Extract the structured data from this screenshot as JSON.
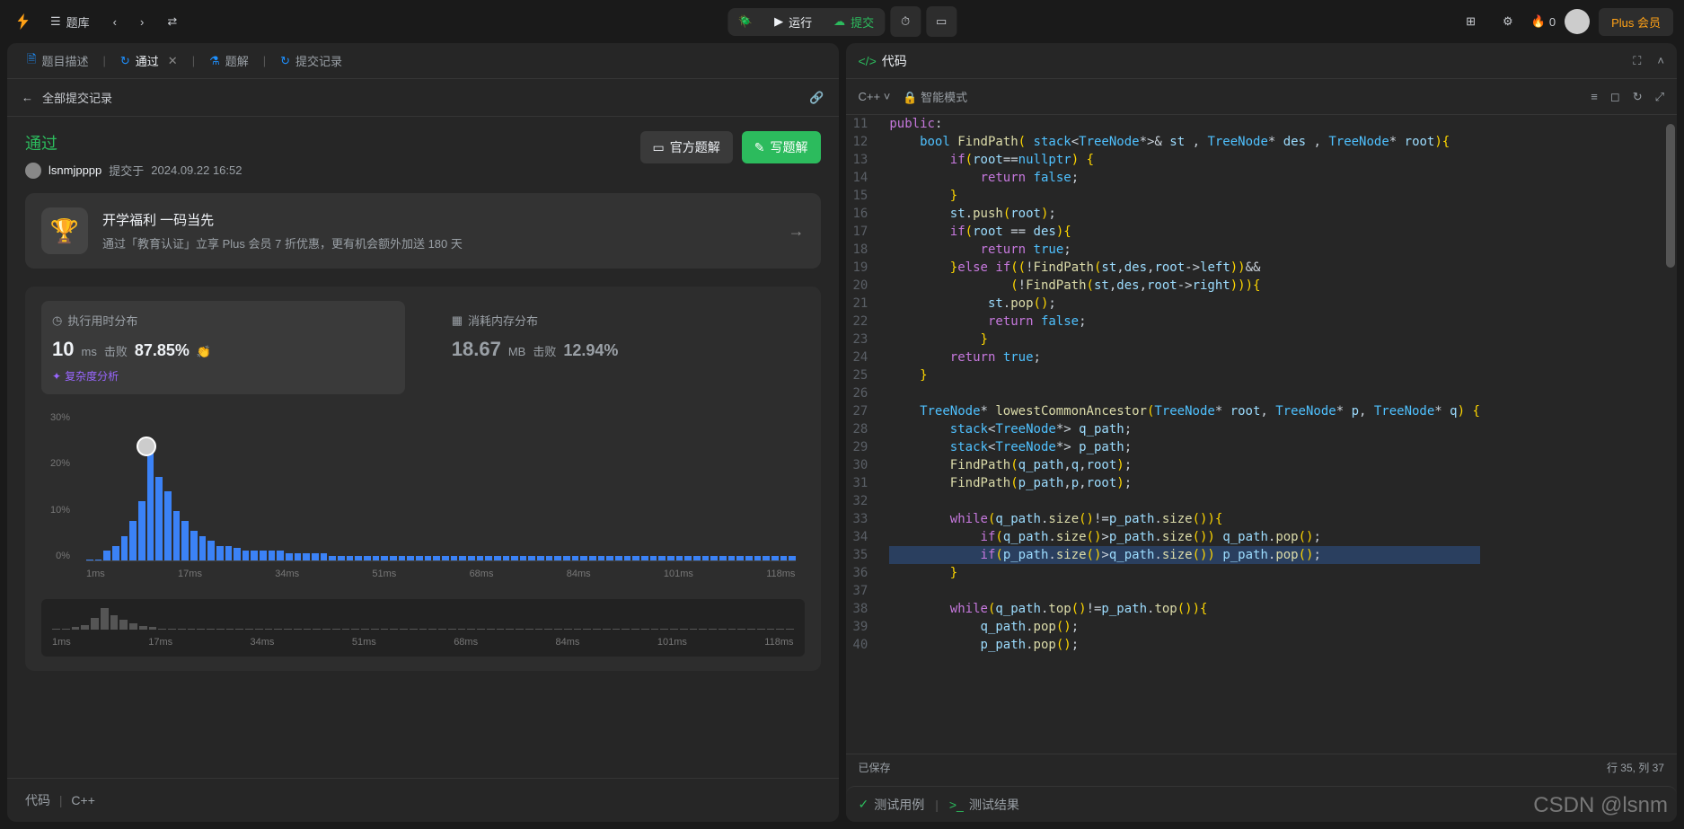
{
  "topbar": {
    "problem_list": "题库",
    "run": "运行",
    "submit": "提交",
    "flame_count": "0",
    "plus": "Plus 会员"
  },
  "left_tabs": {
    "desc": "题目描述",
    "pass": "通过",
    "solution": "题解",
    "history": "提交记录"
  },
  "subhead": {
    "back": "←",
    "all_sub": "全部提交记录"
  },
  "result": {
    "status": "通过",
    "user": "lsnmjpppp",
    "submitted_prefix": "提交于",
    "submitted_at": "2024.09.22 16:52",
    "official": "官方题解",
    "write": "写题解"
  },
  "promo": {
    "title": "开学福利 一码当先",
    "subtitle": "通过「教育认证」立享 Plus 会员 7 折优惠，更有机会额外加送 180 天"
  },
  "stats": {
    "time_label": "执行用时分布",
    "mem_label": "消耗内存分布",
    "time_val": "10",
    "time_unit": "ms",
    "beat_label": "击败",
    "time_pct": "87.85%",
    "mem_val": "18.67",
    "mem_unit": "MB",
    "mem_pct": "12.94%",
    "complexity": "复杂度分析"
  },
  "chart_data": {
    "type": "bar",
    "ylabel": "",
    "ylim": [
      0,
      30
    ],
    "yticks": [
      "0%",
      "10%",
      "20%",
      "30%"
    ],
    "xticks": [
      "1ms",
      "17ms",
      "34ms",
      "51ms",
      "68ms",
      "84ms",
      "101ms",
      "118ms"
    ],
    "values": [
      0,
      0,
      2,
      3,
      5,
      8,
      12,
      22,
      17,
      14,
      10,
      8,
      6,
      5,
      4,
      3,
      3,
      2.5,
      2,
      2,
      2,
      2,
      2,
      1.5,
      1.5,
      1.5,
      1.5,
      1.5,
      1,
      1,
      1,
      1,
      1,
      1,
      1,
      1,
      1,
      1,
      1,
      1,
      1,
      1,
      1,
      1,
      1,
      1,
      1,
      1,
      1,
      1,
      1,
      1,
      1,
      1,
      1,
      1,
      1,
      1,
      1,
      1,
      1,
      1,
      1,
      1,
      1,
      1,
      1,
      1,
      1,
      1,
      1,
      1,
      1,
      1,
      1,
      1,
      1,
      1,
      1,
      1,
      1,
      1
    ],
    "user_index": 7,
    "mini_values": [
      0,
      0,
      2,
      4,
      10,
      18,
      12,
      8,
      5,
      3,
      2,
      1,
      1,
      1,
      1,
      1,
      1,
      0,
      0,
      0,
      0,
      0,
      0,
      0,
      0,
      0,
      0,
      0,
      0,
      0,
      0,
      0,
      0,
      0,
      0,
      0,
      0,
      0,
      0,
      0,
      0,
      0,
      0,
      0,
      0,
      0,
      0,
      0,
      0,
      0,
      0,
      0,
      0,
      0,
      0,
      0,
      0,
      0,
      0,
      0,
      0,
      0,
      0,
      0,
      0,
      0,
      0,
      0,
      0,
      0,
      0,
      0,
      0,
      0,
      0,
      0,
      0
    ]
  },
  "code_footer": {
    "label": "代码",
    "lang": "C++"
  },
  "right": {
    "title": "代码",
    "lang": "C++",
    "smart": "智能模式",
    "saved": "已保存",
    "cursor": "行 35,  列 37",
    "test_case": "测试用例",
    "test_result": "测试结果"
  },
  "code": {
    "lines": [
      {
        "n": 11,
        "html": "<span class='kw'>public</span><span class='pun'>:</span>"
      },
      {
        "n": 12,
        "html": "    <span class='ty'>bool</span> <span class='fn'>FindPath</span><span class='br'>(</span> <span class='ty'>stack</span>&lt;<span class='ty'>TreeNode</span>*&gt;&amp; <span class='id'>st</span> , <span class='ty'>TreeNode</span>* <span class='id'>des</span> , <span class='ty'>TreeNode</span>* <span class='id'>root</span><span class='br'>){</span>"
      },
      {
        "n": 13,
        "html": "        <span class='kw'>if</span><span class='br'>(</span><span class='id'>root</span>==<span class='bool'>nullptr</span><span class='br'>)</span> <span class='br'>{</span>"
      },
      {
        "n": 14,
        "html": "            <span class='kw'>return</span> <span class='bool'>false</span>;"
      },
      {
        "n": 15,
        "html": "        <span class='br'>}</span>"
      },
      {
        "n": 16,
        "html": "        <span class='id'>st</span>.<span class='fn'>push</span><span class='br'>(</span><span class='id'>root</span><span class='br'>)</span>;"
      },
      {
        "n": 17,
        "html": "        <span class='kw'>if</span><span class='br'>(</span><span class='id'>root</span> == <span class='id'>des</span><span class='br'>){</span>"
      },
      {
        "n": 18,
        "html": "            <span class='kw'>return</span> <span class='bool'>true</span>;"
      },
      {
        "n": 19,
        "html": "        <span class='br'>}</span><span class='kw'>else</span> <span class='kw'>if</span><span class='br'>((</span>!<span class='fn'>FindPath</span><span class='br'>(</span><span class='id'>st</span>,<span class='id'>des</span>,<span class='id'>root</span>-&gt;<span class='id'>left</span><span class='br'>))</span>&amp;&amp;"
      },
      {
        "n": 20,
        "html": "                <span class='br'>(</span>!<span class='fn'>FindPath</span><span class='br'>(</span><span class='id'>st</span>,<span class='id'>des</span>,<span class='id'>root</span>-&gt;<span class='id'>right</span><span class='br'>))){</span>"
      },
      {
        "n": 21,
        "html": "             <span class='id'>st</span>.<span class='fn'>pop</span><span class='br'>()</span>;"
      },
      {
        "n": 22,
        "html": "             <span class='kw'>return</span> <span class='bool'>false</span>;"
      },
      {
        "n": 23,
        "html": "            <span class='br'>}</span>"
      },
      {
        "n": 24,
        "html": "        <span class='kw'>return</span> <span class='bool'>true</span>;"
      },
      {
        "n": 25,
        "html": "    <span class='br'>}</span>"
      },
      {
        "n": 26,
        "html": ""
      },
      {
        "n": 27,
        "html": "    <span class='ty'>TreeNode</span>* <span class='fn'>lowestCommonAncestor</span><span class='br'>(</span><span class='ty'>TreeNode</span>* <span class='id'>root</span>, <span class='ty'>TreeNode</span>* <span class='id'>p</span>, <span class='ty'>TreeNode</span>* <span class='id'>q</span><span class='br'>)</span> <span class='br'>{</span>"
      },
      {
        "n": 28,
        "html": "        <span class='ty'>stack</span>&lt;<span class='ty'>TreeNode</span>*&gt; <span class='id'>q_path</span>;"
      },
      {
        "n": 29,
        "html": "        <span class='ty'>stack</span>&lt;<span class='ty'>TreeNode</span>*&gt; <span class='id'>p_path</span>;"
      },
      {
        "n": 30,
        "html": "        <span class='fn'>FindPath</span><span class='br'>(</span><span class='id'>q_path</span>,<span class='id'>q</span>,<span class='id'>root</span><span class='br'>)</span>;"
      },
      {
        "n": 31,
        "html": "        <span class='fn'>FindPath</span><span class='br'>(</span><span class='id'>p_path</span>,<span class='id'>p</span>,<span class='id'>root</span><span class='br'>)</span>;"
      },
      {
        "n": 32,
        "html": ""
      },
      {
        "n": 33,
        "html": "        <span class='kw'>while</span><span class='br'>(</span><span class='id'>q_path</span>.<span class='fn'>size</span><span class='br'>()</span>!=<span class='id'>p_path</span>.<span class='fn'>size</span><span class='br'>()){</span>"
      },
      {
        "n": 34,
        "html": "            <span class='kw'>if</span><span class='br'>(</span><span class='id'>q_path</span>.<span class='fn'>size</span><span class='br'>()</span>&gt;<span class='id'>p_path</span>.<span class='fn'>size</span><span class='br'>())</span> <span class='id'>q_path</span>.<span class='fn'>pop</span><span class='br'>()</span>;"
      },
      {
        "n": 35,
        "html": "            <span class='kw'>if</span><span class='br'>(</span><span class='id'>p_path</span>.<span class='fn'>size</span><span class='br'>()</span>&gt;<span class='id'>q_path</span>.<span class='fn'>size</span><span class='br'>())</span> <span class='id'>p_path</span>.<span class='fn'>pop</span><span class='br'>()</span>;",
        "highlight": true
      },
      {
        "n": 36,
        "html": "        <span class='br'>}</span>"
      },
      {
        "n": 37,
        "html": ""
      },
      {
        "n": 38,
        "html": "        <span class='kw'>while</span><span class='br'>(</span><span class='id'>q_path</span>.<span class='fn'>top</span><span class='br'>()</span>!=<span class='id'>p_path</span>.<span class='fn'>top</span><span class='br'>()){</span>"
      },
      {
        "n": 39,
        "html": "            <span class='id'>q_path</span>.<span class='fn'>pop</span><span class='br'>()</span>;"
      },
      {
        "n": 40,
        "html": "            <span class='id'>p_path</span>.<span class='fn'>pop</span><span class='br'>()</span>;"
      }
    ]
  },
  "watermark": "CSDN @lsnm"
}
